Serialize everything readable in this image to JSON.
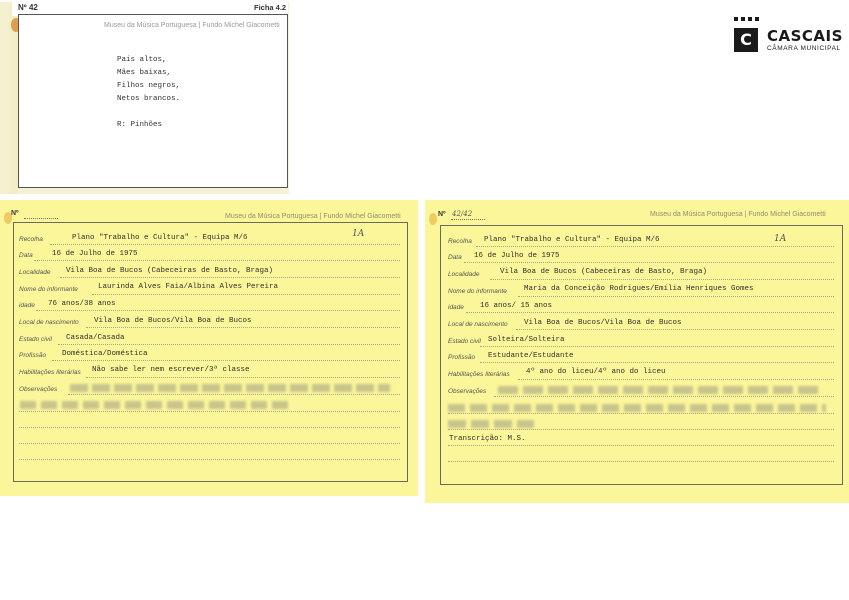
{
  "logo": {
    "name": "CASCAIS",
    "subtitle": "CÂMARA MUNICIPAL",
    "mark": "C"
  },
  "card_top": {
    "number_label": "Nº",
    "number": "42",
    "ficha": "Ficha 4.2",
    "institution": "Museu da Música Portuguesa | Fundo Michel Giacometti",
    "lines": [
      "Pais altos,",
      "Mães baixas,",
      "Filhos negros,",
      "Netos brancos."
    ],
    "footer": "R: Pinhões"
  },
  "card_left": {
    "number_label": "Nº",
    "institution": "Museu da Música Portuguesa | Fundo Michel Giacometti",
    "handmark": "1A",
    "fields": {
      "recolha_label": "Recolha",
      "recolha": "Plano \"Trabalho e Cultura\" - Equipa M/6",
      "data_label": "Data",
      "data": "16 de Julho de 1975",
      "localidade_label": "Localidade",
      "localidade": "Vila Boa de Bucos (Cabeceiras de Basto, Braga)",
      "informante_label": "Nome do informante",
      "informante": "Laurinda Alves Faia/Albina Alves Pereira",
      "idade_label": "idade",
      "idade": "76 anos/38 anos",
      "nascimento_label": "Local de nascimento",
      "nascimento": "Vila Boa de Bucos/Vila Boa de Bucos",
      "civil_label": "Estado civil",
      "civil": "Casada/Casada",
      "profissao_label": "Profissão",
      "profissao": "Doméstica/Doméstica",
      "habilitacoes_label": "Habilitações literárias",
      "habilitacoes": "Não sabe ler nem escrever/3ª classe",
      "observacoes_label": "Observações"
    }
  },
  "card_right": {
    "number_label": "Nº",
    "number": "42/42",
    "institution": "Museu da Música Portuguesa | Fundo Michel Giacometti",
    "handmark": "1A",
    "fields": {
      "recolha_label": "Recolha",
      "recolha": "Plano \"Trabalho e Cultura\" - Equipa M/6",
      "data_label": "Data",
      "data": "16 de Julho de 1975",
      "localidade_label": "Localidade",
      "localidade": "Vila Boa de Bucos (Cabeceiras de Basto, Braga)",
      "informante_label": "Nome do informante",
      "informante": "Maria da Conceição Rodrigues/Emília Henriques Gomes",
      "idade_label": "idade",
      "idade": "16 anos/ 15 anos",
      "nascimento_label": "Local de nascimento",
      "nascimento": "Vila Boa de Bucos/Vila Boa de Bucos",
      "civil_label": "Estado civil",
      "civil": "Solteira/Solteira",
      "profissao_label": "Profissão",
      "profissao": "Estudante/Estudante",
      "habilitacoes_label": "Habilitações literárias",
      "habilitacoes": "4º ano do liceu/4º ano do liceu",
      "observacoes_label": "Observações",
      "transcricao": "Transcrição: M.S."
    }
  }
}
